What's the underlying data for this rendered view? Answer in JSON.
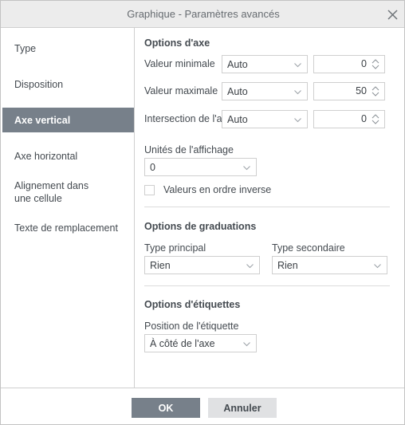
{
  "window": {
    "title": "Graphique - Paramètres avancés",
    "close_icon": "close-icon"
  },
  "sidebar": {
    "items": [
      {
        "label": "Type",
        "selected": false
      },
      {
        "label": "Disposition",
        "selected": false
      },
      {
        "label": "Axe vertical",
        "selected": true
      },
      {
        "label": "Axe horizontal",
        "selected": false
      },
      {
        "label": "Alignement dans une cellule",
        "selected": false
      },
      {
        "label": "Texte de remplacement",
        "selected": false
      }
    ]
  },
  "panel": {
    "axis_options": {
      "title": "Options d'axe",
      "min_label": "Valeur minimale",
      "min_select": "Auto",
      "min_value": "0",
      "max_label": "Valeur maximale",
      "max_select": "Auto",
      "max_value": "50",
      "cross_label": "Intersection de l'axe",
      "cross_select": "Auto",
      "cross_value": "0",
      "units_label": "Unités de l'affichage",
      "units_select": "0",
      "reverse_checkbox_label": "Valeurs en ordre inverse",
      "reverse_checked": false
    },
    "tick_options": {
      "title": "Options de graduations",
      "major_label": "Type principal",
      "major_select": "Rien",
      "minor_label": "Type secondaire",
      "minor_select": "Rien"
    },
    "label_options": {
      "title": "Options d'étiquettes",
      "position_label": "Position de l'étiquette",
      "position_select": "À côté de l'axe"
    }
  },
  "footer": {
    "ok_label": "OK",
    "cancel_label": "Annuler"
  },
  "colors": {
    "titlebar_bg": "#ececec",
    "selected_bg": "#77808a",
    "ok_bg": "#77808a",
    "cancel_bg": "#e0e1e3",
    "border": "#cfcfcf"
  }
}
